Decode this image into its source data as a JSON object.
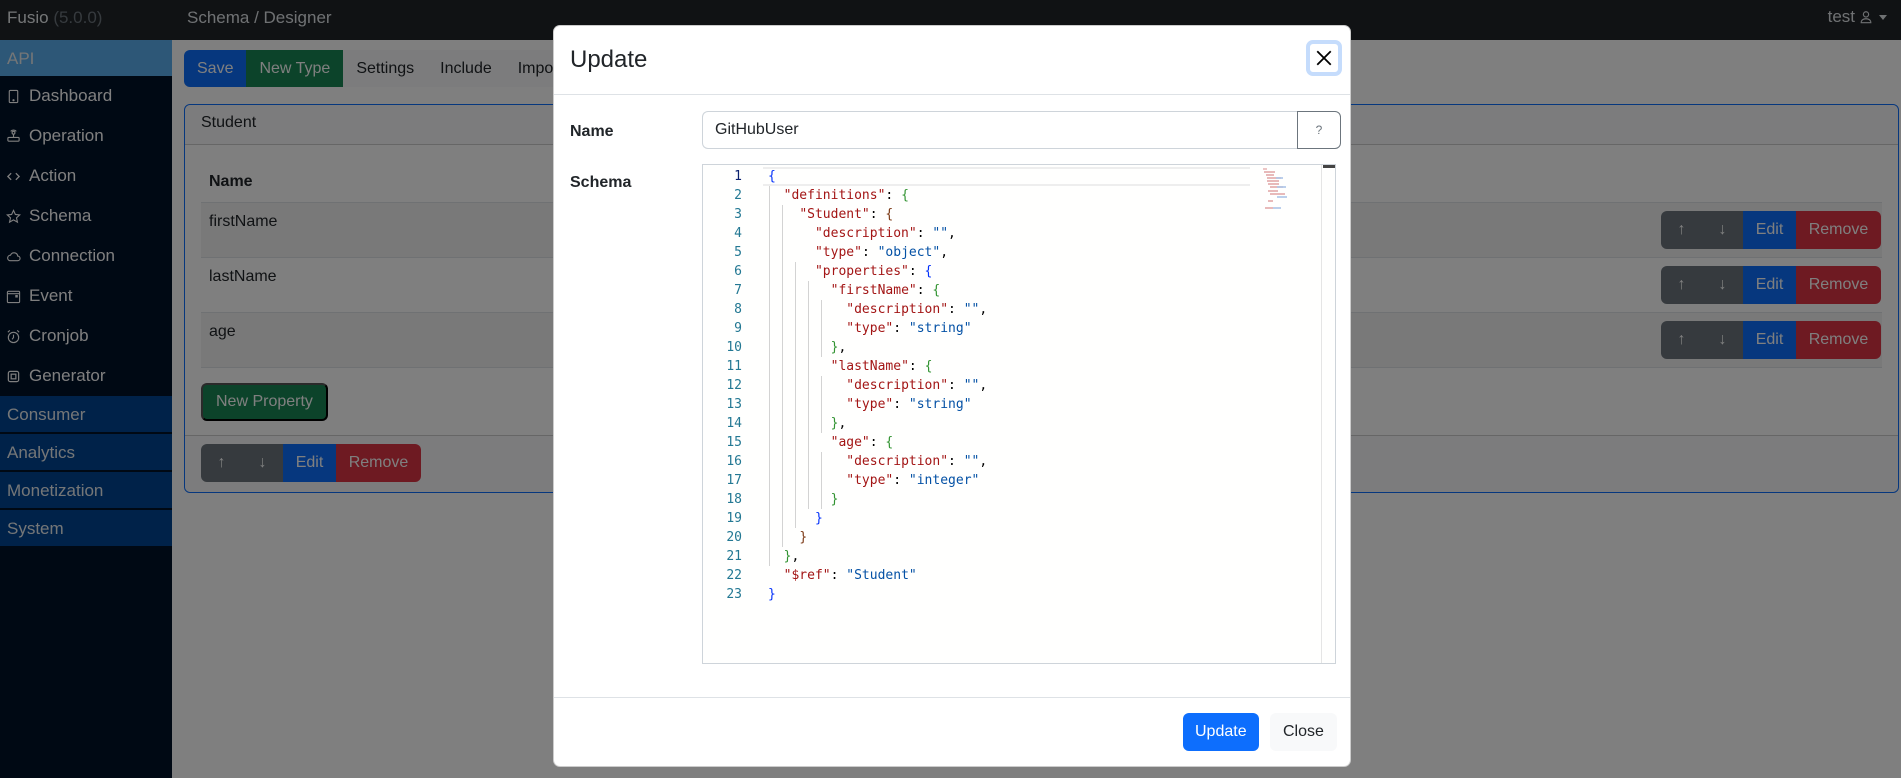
{
  "topbar": {
    "brand": "Fusio",
    "version": "(5.0.0)",
    "breadcrumb": "Schema / Designer",
    "user": "test",
    "user_icon": "person-icon"
  },
  "sidebar": {
    "section_api": "API",
    "items": [
      {
        "label": "Dashboard",
        "icon": "tablet-icon"
      },
      {
        "label": "Operation",
        "icon": "router-icon"
      },
      {
        "label": "Action",
        "icon": "code-icon"
      },
      {
        "label": "Schema",
        "icon": "star-icon"
      },
      {
        "label": "Connection",
        "icon": "cloud-icon"
      },
      {
        "label": "Event",
        "icon": "calendar-icon"
      },
      {
        "label": "Cronjob",
        "icon": "alarm-icon"
      },
      {
        "label": "Generator",
        "icon": "cpu-icon"
      }
    ],
    "categories": [
      "Consumer",
      "Analytics",
      "Monetization",
      "System"
    ]
  },
  "toolbar": {
    "save": "Save",
    "new_type": "New Type",
    "settings": "Settings",
    "include": "Include",
    "import": "Import"
  },
  "type_card": {
    "title": "Student",
    "column_header": "Name",
    "properties": [
      "firstName",
      "lastName",
      "age"
    ],
    "row_actions": {
      "up": "↑",
      "down": "↓",
      "edit": "Edit",
      "remove": "Remove"
    },
    "new_property": "New Property"
  },
  "modal": {
    "title": "Update",
    "name_label": "Name",
    "name_value": "GitHubUser",
    "help_button": "?",
    "schema_label": "Schema",
    "update_button": "Update",
    "close_button": "Close",
    "code_lines": [
      "{",
      "  \"definitions\": {",
      "    \"Student\": {",
      "      \"description\": \"\",",
      "      \"type\": \"object\",",
      "      \"properties\": {",
      "        \"firstName\": {",
      "          \"description\": \"\",",
      "          \"type\": \"string\"",
      "        },",
      "        \"lastName\": {",
      "          \"description\": \"\",",
      "          \"type\": \"string\"",
      "        },",
      "        \"age\": {",
      "          \"description\": \"\",",
      "          \"type\": \"integer\"",
      "        }",
      "      }",
      "    }",
      "  },",
      "  \"$ref\": \"Student\"",
      "}"
    ]
  },
  "colors": {
    "primary": "#0d6efd",
    "success": "#198754",
    "danger": "#dc3545",
    "secondary": "#6c757d",
    "sidebar_bg": "#001229",
    "sidebar_category": "#004593",
    "sidebar_active": "#5aafef"
  }
}
